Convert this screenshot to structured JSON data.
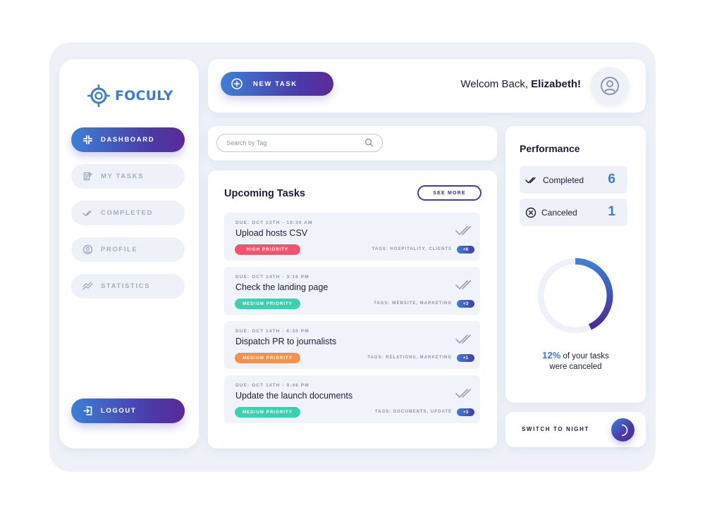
{
  "brand": {
    "name": "FOCULY"
  },
  "sidebar": {
    "items": [
      {
        "label": "DASHBOARD",
        "icon": "dashboard-icon",
        "active": true
      },
      {
        "label": "MY TASKS",
        "icon": "tasks-icon",
        "active": false
      },
      {
        "label": "COMPLETED",
        "icon": "check-icon",
        "active": false
      },
      {
        "label": "PROFILE",
        "icon": "profile-icon",
        "active": false
      },
      {
        "label": "STATISTICS",
        "icon": "chart-icon",
        "active": false
      }
    ],
    "logout_label": "LOGOUT"
  },
  "header": {
    "new_task_label": "NEW TASK",
    "welcome_text": "Welcom Back, ",
    "user_name": "Elizabeth!"
  },
  "search": {
    "placeholder": "Search by Tag"
  },
  "tasks": {
    "title": "Upcoming Tasks",
    "see_more_label": "SEE MORE",
    "items": [
      {
        "due": "DUE: OCT 13TH - 10:30 AM",
        "title": "Upload hosts CSV",
        "priority": "HIGH PRIORITY",
        "priority_color": "#f2556a",
        "tags": "TAGS: HOSPITALITY, CLIENTS",
        "extra": "+6"
      },
      {
        "due": "DUE: OCT 14TH - 3:16 PM",
        "title": "Check the landing page",
        "priority": "MEDIUM PRIORITY",
        "priority_color": "#3ecfb0",
        "tags": "TAGS: WEBSITE, MARKETING",
        "extra": "+3"
      },
      {
        "due": "DUE: OCT 14TH - 6:30 PM",
        "title": "Dispatch PR to journalists",
        "priority": "MEDIUM PRIORITY",
        "priority_color": "#f7914a",
        "tags": "TAGS: RELATIONS, MARKETING",
        "extra": "+1"
      },
      {
        "due": "DUE: OCT 14TH - 9:46 PM",
        "title": "Update the launch documents",
        "priority": "MEDIUM PRIORITY",
        "priority_color": "#3ecfb0",
        "tags": "TAGS: DOCUMENTS, UPDATE",
        "extra": "+3"
      }
    ]
  },
  "performance": {
    "title": "Performance",
    "completed_label": "Completed",
    "completed_value": "6",
    "canceled_label": "Canceled",
    "canceled_value": "1",
    "donut_fraction": 0.43,
    "caption_pct": "12%",
    "caption_line1": " of your tasks",
    "caption_line2": "were canceled"
  },
  "night": {
    "label": "SWITCH TO NIGHT"
  },
  "colors": {
    "accent": "#3b7bd4",
    "brand_purple": "#4a3aa8",
    "bg": "#eef2f8"
  }
}
